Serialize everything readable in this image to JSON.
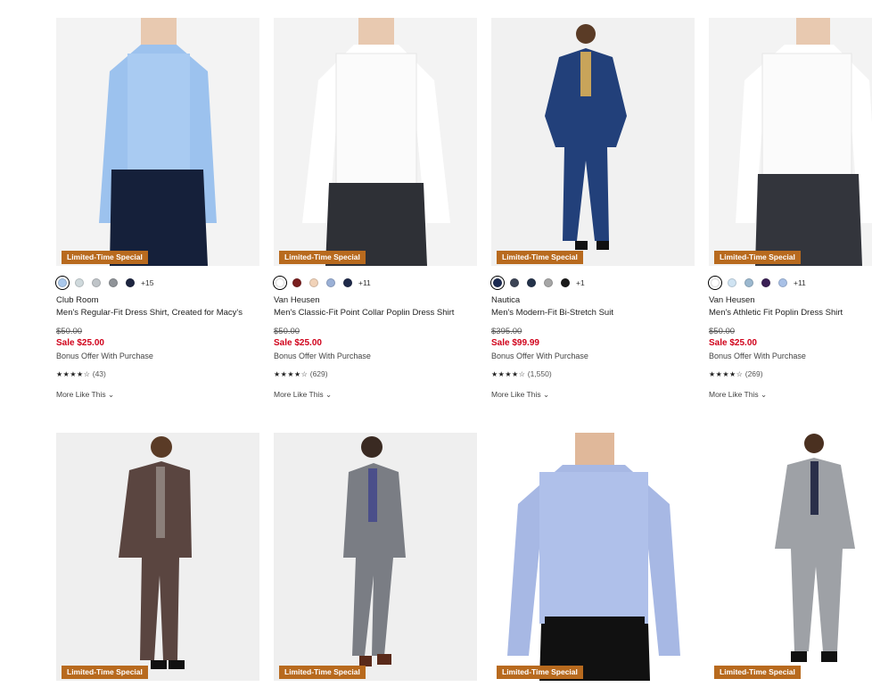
{
  "products": [
    {
      "badge": "Limited-Time Special",
      "swatches": [
        "#a9c8ec",
        "#cfd9dc",
        "#bfc4c8",
        "#8f9398",
        "#1d2540"
      ],
      "more_colors": "+15",
      "brand": "Club Room",
      "name": "Men's Regular-Fit Dress Shirt, Created for Macy's",
      "original_price": "$50.00",
      "sale_price": "Sale $25.00",
      "offer": "Bonus Offer With Purchase",
      "stars": "★★★★☆",
      "reviews": "(43)",
      "more_like": "More Like This"
    },
    {
      "badge": "Limited-Time Special",
      "swatches": [
        "#ffffff",
        "#7a1e1e",
        "#f1d2b8",
        "#9ab0d6",
        "#1f2a4a"
      ],
      "more_colors": "+11",
      "brand": "Van Heusen",
      "name": "Men's Classic-Fit Point Collar Poplin Dress Shirt",
      "original_price": "$50.00",
      "sale_price": "Sale $25.00",
      "offer": "Bonus Offer With Purchase",
      "stars": "★★★★☆",
      "reviews": "(629)",
      "more_like": "More Like This"
    },
    {
      "badge": "Limited-Time Special",
      "swatches": [
        "#1b2a52",
        "#3c4456",
        "#24324a",
        "#a6a6a6",
        "#1a1a1a"
      ],
      "more_colors": "+1",
      "brand": "Nautica",
      "name": "Men's Modern-Fit Bi-Stretch Suit",
      "original_price": "$395.00",
      "sale_price": "Sale $99.99",
      "offer": "Bonus Offer With Purchase",
      "stars": "★★★★☆",
      "reviews": "(1,550)",
      "more_like": "More Like This"
    },
    {
      "badge": "Limited-Time Special",
      "swatches": [
        "#ffffff",
        "#cfe3f2",
        "#9bb8cf",
        "#3a1f55",
        "#a8c0e6"
      ],
      "more_colors": "+11",
      "brand": "Van Heusen",
      "name": "Men's Athletic Fit Poplin Dress Shirt",
      "original_price": "$50.00",
      "sale_price": "Sale $25.00",
      "offer": "Bonus Offer With Purchase",
      "stars": "★★★★☆",
      "reviews": "(269)",
      "more_like": "More Like This"
    }
  ],
  "row2_badges": [
    "Limited-Time Special",
    "Limited-Time Special",
    "Limited-Time Special",
    "Limited-Time Special"
  ],
  "colors": {
    "badge_bg": "#b86a1e",
    "sale_red": "#d0021b"
  }
}
